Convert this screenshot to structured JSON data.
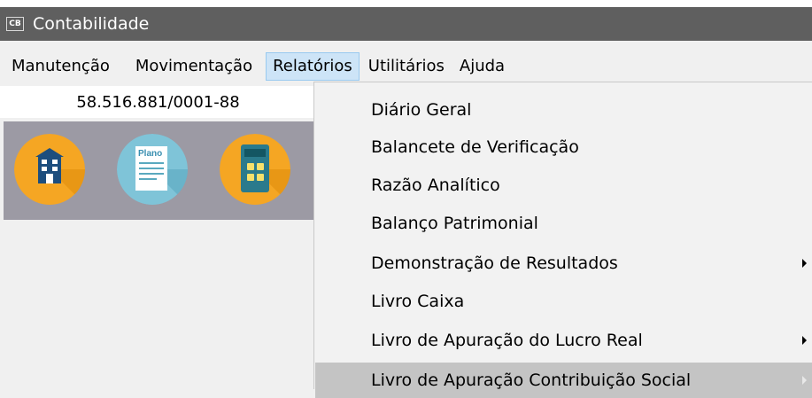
{
  "window": {
    "app_icon_text": "CB",
    "title": "Contabilidade"
  },
  "menubar": {
    "items": [
      {
        "label": "Manutenção"
      },
      {
        "label": "Movimentação"
      },
      {
        "label": "Relatórios"
      },
      {
        "label": "Utilitários"
      },
      {
        "label": "Ajuda"
      }
    ]
  },
  "company": {
    "cnpj": "58.516.881/0001-88"
  },
  "toolbar": {
    "buttons": [
      {
        "icon": "building-icon"
      },
      {
        "icon": "plano-document-icon",
        "text": "Plano"
      },
      {
        "icon": "calculator-icon"
      }
    ],
    "colors": {
      "building_bg": "#f5a623",
      "plano_bg": "#7fc4d8",
      "calculator_bg": "#f5a623"
    }
  },
  "reports_menu": {
    "items": [
      {
        "label": "Diário Geral",
        "submenu": false
      },
      {
        "label": "Balancete de Verificação",
        "submenu": false
      },
      {
        "label": "Razão Analítico",
        "submenu": false
      },
      {
        "label": "Balanço Patrimonial",
        "submenu": false
      },
      {
        "label": "Demonstração de Resultados",
        "submenu": true
      },
      {
        "label": "Livro Caixa",
        "submenu": false
      },
      {
        "label": "Livro de Apuração do Lucro Real",
        "submenu": true
      },
      {
        "label": "Livro de Apuração Contribuição Social",
        "submenu": true
      }
    ]
  }
}
